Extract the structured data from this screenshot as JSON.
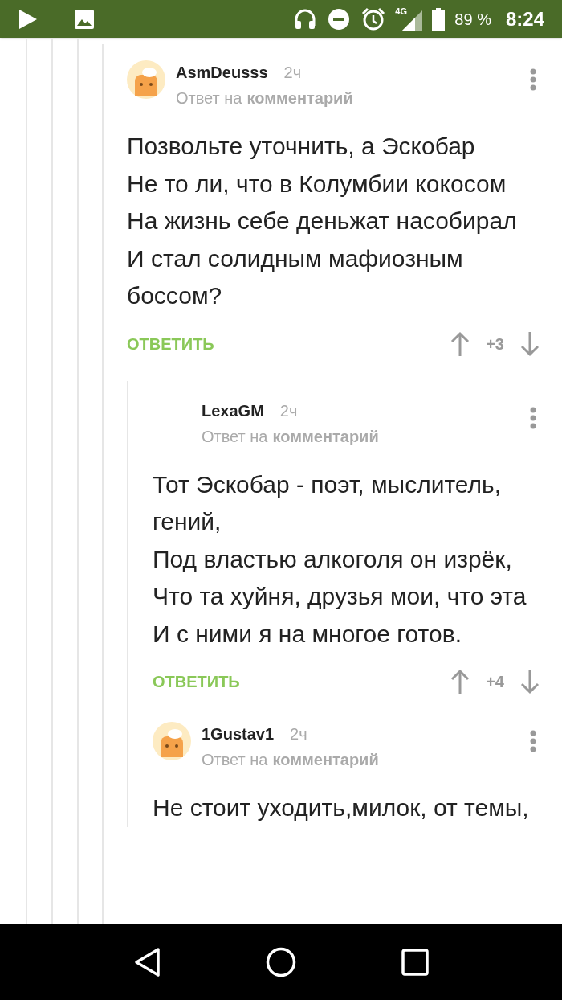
{
  "status_bar": {
    "network": "4G",
    "battery": "89 %",
    "time": "8:24"
  },
  "comments": [
    {
      "author": "AsmDeusss",
      "time": "2ч",
      "reply_prefix": "Ответ на",
      "reply_target": "комментарий",
      "avatar": true,
      "depth_line": false,
      "lines": [
        "Позвольте уточнить, а Эскобар",
        "Не то ли, что в Колумбии кокосом",
        "На жизнь себе деньжат насобирал",
        "И стал солидным мафиозным боссом?"
      ],
      "reply_label": "ОТВЕТИТЬ",
      "score": "+3"
    },
    {
      "author": "LexaGM",
      "time": "2ч",
      "reply_prefix": "Ответ на",
      "reply_target": "комментарий",
      "avatar": false,
      "depth_line": true,
      "lines": [
        "Тот Эскобар - поэт, мыслитель, гений,",
        "Под властью алкоголя он изрёк,",
        "Что та хуйня, друзья мои, что эта",
        "И с ними я на многое готов."
      ],
      "reply_label": "ОТВЕТИТЬ",
      "score": "+4"
    },
    {
      "author": "1Gustav1",
      "time": "2ч",
      "reply_prefix": "Ответ на",
      "reply_target": "комментарий",
      "avatar": true,
      "depth_line": true,
      "lines": [
        "Не стоит уходить,милок, от темы,"
      ]
    }
  ]
}
